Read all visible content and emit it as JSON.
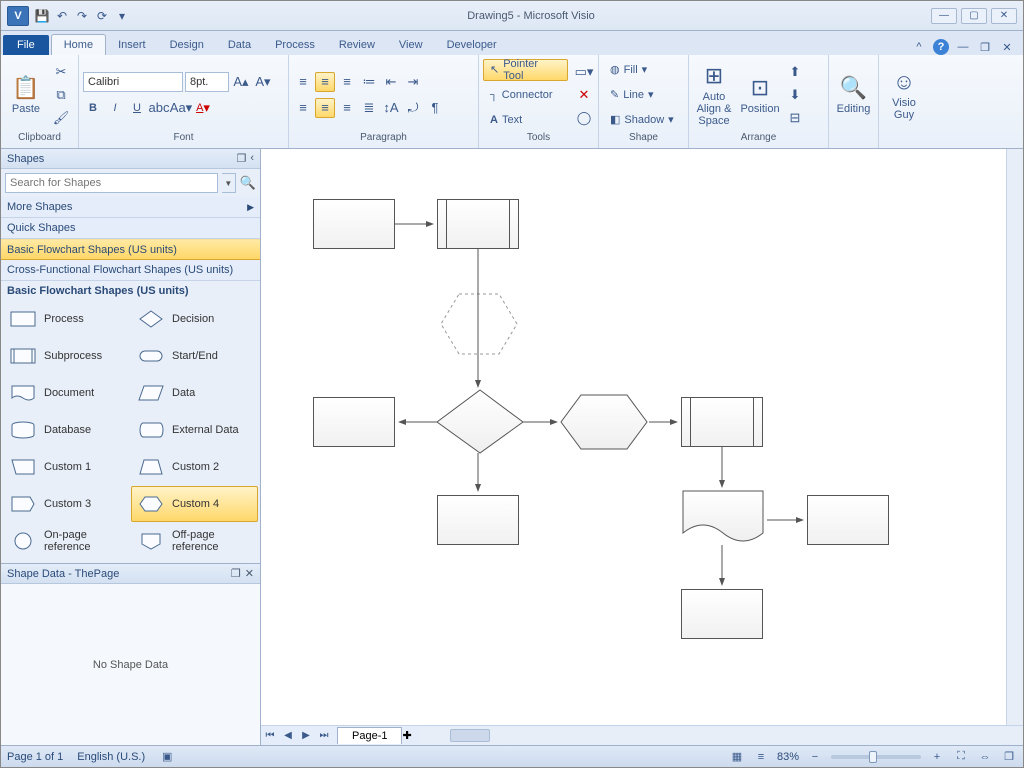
{
  "title": "Drawing5  -  Microsoft Visio",
  "qat_icons": [
    "save-icon",
    "undo-icon",
    "redo-icon",
    "repeat-icon",
    "touch-icon"
  ],
  "tabs": {
    "file": "File",
    "items": [
      "Home",
      "Insert",
      "Design",
      "Data",
      "Process",
      "Review",
      "View",
      "Developer"
    ],
    "active": "Home"
  },
  "ribbon": {
    "clipboard": {
      "label": "Clipboard",
      "paste": "Paste"
    },
    "font": {
      "label": "Font",
      "name": "Calibri",
      "size": "8pt."
    },
    "paragraph": {
      "label": "Paragraph"
    },
    "tools": {
      "label": "Tools",
      "pointer": "Pointer Tool",
      "connector": "Connector",
      "text": "Text"
    },
    "shape": {
      "label": "Shape",
      "fill": "Fill",
      "line": "Line",
      "shadow": "Shadow"
    },
    "arrange": {
      "label": "Arrange",
      "autoalign": "Auto Align & Space",
      "position": "Position"
    },
    "editing": {
      "label": "Editing",
      "btn": "Editing"
    },
    "visioguy": {
      "label": "",
      "btn": "Visio Guy"
    }
  },
  "shapes_panel": {
    "title": "Shapes",
    "search_placeholder": "Search for Shapes",
    "more": "More Shapes",
    "quick": "Quick Shapes",
    "basic": "Basic Flowchart Shapes (US units)",
    "cross": "Cross-Functional Flowchart Shapes (US units)",
    "stencil_title": "Basic Flowchart Shapes (US units)",
    "shapes": [
      {
        "n": "Process"
      },
      {
        "n": "Decision"
      },
      {
        "n": "Subprocess"
      },
      {
        "n": "Start/End"
      },
      {
        "n": "Document"
      },
      {
        "n": "Data"
      },
      {
        "n": "Database"
      },
      {
        "n": "External Data"
      },
      {
        "n": "Custom 1"
      },
      {
        "n": "Custom 2"
      },
      {
        "n": "Custom 3"
      },
      {
        "n": "Custom 4"
      },
      {
        "n": "On-page reference"
      },
      {
        "n": "Off-page reference"
      }
    ]
  },
  "shapedata": {
    "title": "Shape Data - ThePage",
    "empty": "No Shape Data"
  },
  "page_tab": "Page-1",
  "status": {
    "page": "Page 1 of 1",
    "lang": "English (U.S.)",
    "zoom": "83%"
  }
}
